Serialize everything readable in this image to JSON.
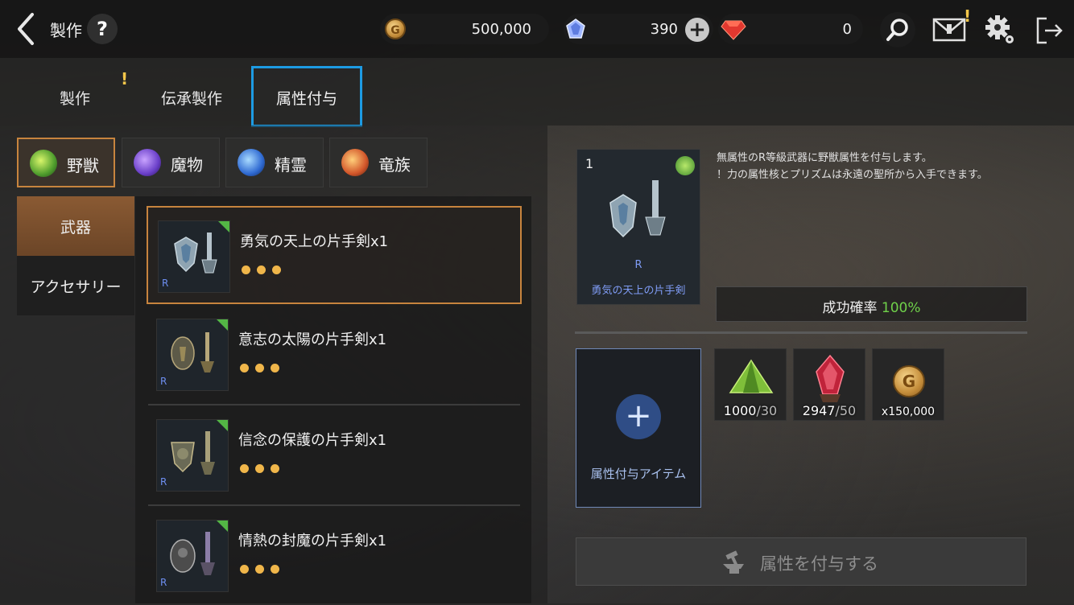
{
  "header": {
    "back_icon": "chevron-left-icon",
    "title": "製作",
    "help_label": "?",
    "gold": "500,000",
    "crystal": "390",
    "ruby": "0",
    "add_label": "+",
    "alert": "!"
  },
  "tabs": [
    {
      "label": "製作",
      "alert": "!"
    },
    {
      "label": "伝承製作"
    },
    {
      "label": "属性付与",
      "selected": true
    }
  ],
  "elements": [
    {
      "label": "野獣",
      "icon": "beast-icon",
      "active": true
    },
    {
      "label": "魔物",
      "icon": "demon-icon"
    },
    {
      "label": "精霊",
      "icon": "spirit-icon"
    },
    {
      "label": "竜族",
      "icon": "dragon-icon"
    }
  ],
  "categories": [
    {
      "label": "武器",
      "active": true
    },
    {
      "label": "アクセサリー"
    }
  ],
  "items": [
    {
      "name": "勇気の天上の片手剣x1",
      "rank": "R",
      "selected": true
    },
    {
      "name": "意志の太陽の片手剣x1",
      "rank": "R"
    },
    {
      "name": "信念の保護の片手剣x1",
      "rank": "R"
    },
    {
      "name": "情熱の封魔の片手剣x1",
      "rank": "R"
    }
  ],
  "detail": {
    "count": "1",
    "rank": "R",
    "name": "勇気の天上の片手剣",
    "desc_line1": "無属性のR等級武器に野獣属性を付与します。",
    "desc_line2": "！力の属性核とプリズムは永遠の聖所から入手できます。",
    "rate_label": "成功確率",
    "rate_value": "100%",
    "slot_label": "属性付与アイテム",
    "slot_plus": "+"
  },
  "materials": [
    {
      "icon": "green-prism-icon",
      "have": "1000",
      "need": "/30"
    },
    {
      "icon": "red-core-icon",
      "have": "2947",
      "need": "/50"
    },
    {
      "icon": "gold-coin-icon",
      "have": "x150,000",
      "need": ""
    }
  ],
  "action": {
    "label": "属性を付与する"
  },
  "colors": {
    "accent": "#c7843e",
    "tab_highlight": "#1d9be3",
    "rate": "#6fd14a",
    "dots": "#f0b64a"
  }
}
